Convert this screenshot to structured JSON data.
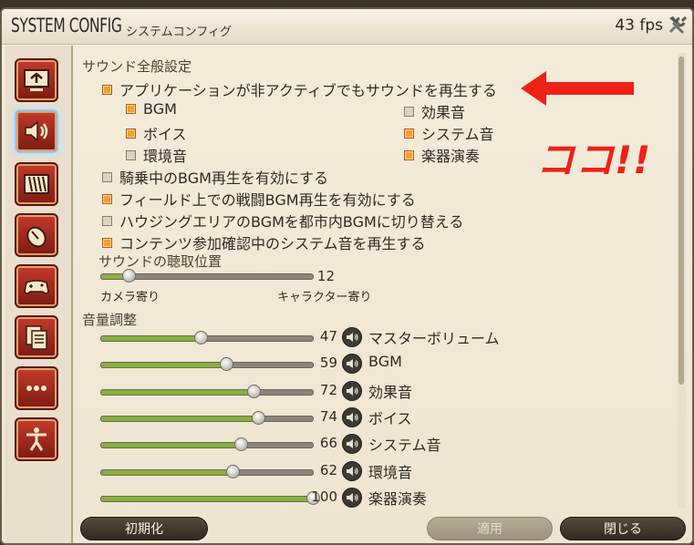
{
  "window": {
    "title": "SYSTEM CONFIG",
    "subtitle": "システムコンフィグ",
    "fps": "43 fps"
  },
  "sidebar": {
    "items": [
      {
        "name": "display-settings-icon"
      },
      {
        "name": "sound-settings-icon",
        "active": true
      },
      {
        "name": "theme-settings-icon"
      },
      {
        "name": "mouse-settings-icon"
      },
      {
        "name": "gamepad-settings-icon"
      },
      {
        "name": "other-settings-icon"
      },
      {
        "name": "more-settings-icon"
      },
      {
        "name": "accessibility-settings-icon"
      }
    ]
  },
  "sound_general": {
    "title": "サウンド全般設定",
    "play_when_inactive": {
      "label": "アプリケーションが非アクティブでもサウンドを再生する",
      "checked": true
    },
    "sub": {
      "bgm": {
        "label": "BGM",
        "checked": true
      },
      "voice": {
        "label": "ボイス",
        "checked": true
      },
      "env": {
        "label": "環境音",
        "checked": false
      },
      "effect": {
        "label": "効果音",
        "checked": false
      },
      "system": {
        "label": "システム音",
        "checked": true
      },
      "instrument": {
        "label": "楽器演奏",
        "checked": true
      }
    },
    "mount_bgm": {
      "label": "騎乗中のBGM再生を有効にする",
      "checked": false
    },
    "field_battle_bgm": {
      "label": "フィールド上での戦闘BGM再生を有効にする",
      "checked": true
    },
    "housing_bgm": {
      "label": "ハウジングエリアのBGMを都市内BGMに切り替える",
      "checked": false
    },
    "content_confirm_sound": {
      "label": "コンテンツ参加確認中のシステム音を再生する",
      "checked": true
    }
  },
  "listening_position": {
    "title": "サウンドの聴取位置",
    "value": "12",
    "left_label": "カメラ寄り",
    "right_label": "キャラクター寄り"
  },
  "volume": {
    "title": "音量調整",
    "sliders": [
      {
        "label": "マスターボリューム",
        "value": "47"
      },
      {
        "label": "BGM",
        "value": "59"
      },
      {
        "label": "効果音",
        "value": "72"
      },
      {
        "label": "ボイス",
        "value": "74"
      },
      {
        "label": "システム音",
        "value": "66"
      },
      {
        "label": "環境音",
        "value": "62"
      },
      {
        "label": "楽器演奏",
        "value": "100"
      }
    ]
  },
  "buttons": {
    "reset": "初期化",
    "apply": "適用",
    "close": "閉じる"
  },
  "annotation": {
    "text": "ココ!!",
    "color": "#ee2116"
  }
}
